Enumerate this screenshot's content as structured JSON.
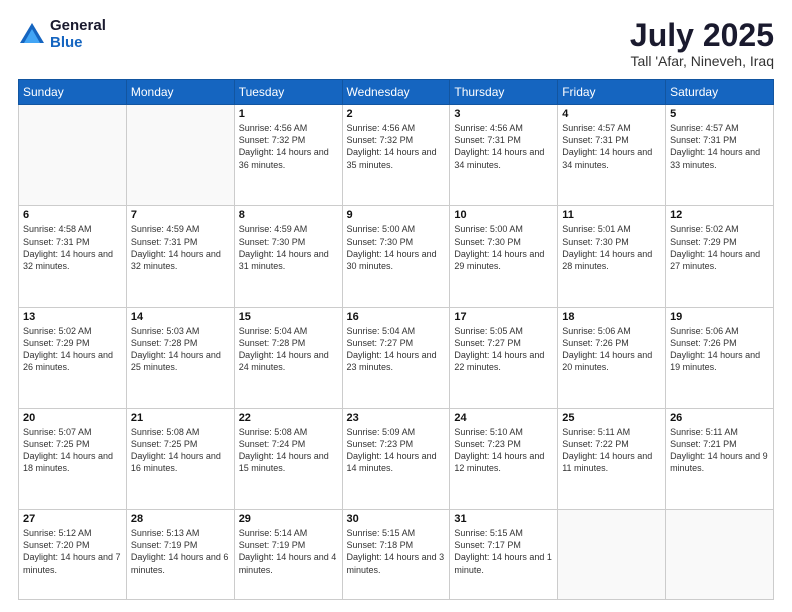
{
  "header": {
    "logo_general": "General",
    "logo_blue": "Blue",
    "title": "July 2025",
    "location": "Tall 'Afar, Nineveh, Iraq"
  },
  "weekdays": [
    "Sunday",
    "Monday",
    "Tuesday",
    "Wednesday",
    "Thursday",
    "Friday",
    "Saturday"
  ],
  "weeks": [
    [
      null,
      null,
      {
        "day": 1,
        "sunrise": "4:56 AM",
        "sunset": "7:32 PM",
        "daylight": "14 hours and 36 minutes."
      },
      {
        "day": 2,
        "sunrise": "4:56 AM",
        "sunset": "7:32 PM",
        "daylight": "14 hours and 35 minutes."
      },
      {
        "day": 3,
        "sunrise": "4:56 AM",
        "sunset": "7:31 PM",
        "daylight": "14 hours and 34 minutes."
      },
      {
        "day": 4,
        "sunrise": "4:57 AM",
        "sunset": "7:31 PM",
        "daylight": "14 hours and 34 minutes."
      },
      {
        "day": 5,
        "sunrise": "4:57 AM",
        "sunset": "7:31 PM",
        "daylight": "14 hours and 33 minutes."
      }
    ],
    [
      {
        "day": 6,
        "sunrise": "4:58 AM",
        "sunset": "7:31 PM",
        "daylight": "14 hours and 32 minutes."
      },
      {
        "day": 7,
        "sunrise": "4:59 AM",
        "sunset": "7:31 PM",
        "daylight": "14 hours and 32 minutes."
      },
      {
        "day": 8,
        "sunrise": "4:59 AM",
        "sunset": "7:30 PM",
        "daylight": "14 hours and 31 minutes."
      },
      {
        "day": 9,
        "sunrise": "5:00 AM",
        "sunset": "7:30 PM",
        "daylight": "14 hours and 30 minutes."
      },
      {
        "day": 10,
        "sunrise": "5:00 AM",
        "sunset": "7:30 PM",
        "daylight": "14 hours and 29 minutes."
      },
      {
        "day": 11,
        "sunrise": "5:01 AM",
        "sunset": "7:30 PM",
        "daylight": "14 hours and 28 minutes."
      },
      {
        "day": 12,
        "sunrise": "5:02 AM",
        "sunset": "7:29 PM",
        "daylight": "14 hours and 27 minutes."
      }
    ],
    [
      {
        "day": 13,
        "sunrise": "5:02 AM",
        "sunset": "7:29 PM",
        "daylight": "14 hours and 26 minutes."
      },
      {
        "day": 14,
        "sunrise": "5:03 AM",
        "sunset": "7:28 PM",
        "daylight": "14 hours and 25 minutes."
      },
      {
        "day": 15,
        "sunrise": "5:04 AM",
        "sunset": "7:28 PM",
        "daylight": "14 hours and 24 minutes."
      },
      {
        "day": 16,
        "sunrise": "5:04 AM",
        "sunset": "7:27 PM",
        "daylight": "14 hours and 23 minutes."
      },
      {
        "day": 17,
        "sunrise": "5:05 AM",
        "sunset": "7:27 PM",
        "daylight": "14 hours and 22 minutes."
      },
      {
        "day": 18,
        "sunrise": "5:06 AM",
        "sunset": "7:26 PM",
        "daylight": "14 hours and 20 minutes."
      },
      {
        "day": 19,
        "sunrise": "5:06 AM",
        "sunset": "7:26 PM",
        "daylight": "14 hours and 19 minutes."
      }
    ],
    [
      {
        "day": 20,
        "sunrise": "5:07 AM",
        "sunset": "7:25 PM",
        "daylight": "14 hours and 18 minutes."
      },
      {
        "day": 21,
        "sunrise": "5:08 AM",
        "sunset": "7:25 PM",
        "daylight": "14 hours and 16 minutes."
      },
      {
        "day": 22,
        "sunrise": "5:08 AM",
        "sunset": "7:24 PM",
        "daylight": "14 hours and 15 minutes."
      },
      {
        "day": 23,
        "sunrise": "5:09 AM",
        "sunset": "7:23 PM",
        "daylight": "14 hours and 14 minutes."
      },
      {
        "day": 24,
        "sunrise": "5:10 AM",
        "sunset": "7:23 PM",
        "daylight": "14 hours and 12 minutes."
      },
      {
        "day": 25,
        "sunrise": "5:11 AM",
        "sunset": "7:22 PM",
        "daylight": "14 hours and 11 minutes."
      },
      {
        "day": 26,
        "sunrise": "5:11 AM",
        "sunset": "7:21 PM",
        "daylight": "14 hours and 9 minutes."
      }
    ],
    [
      {
        "day": 27,
        "sunrise": "5:12 AM",
        "sunset": "7:20 PM",
        "daylight": "14 hours and 7 minutes."
      },
      {
        "day": 28,
        "sunrise": "5:13 AM",
        "sunset": "7:19 PM",
        "daylight": "14 hours and 6 minutes."
      },
      {
        "day": 29,
        "sunrise": "5:14 AM",
        "sunset": "7:19 PM",
        "daylight": "14 hours and 4 minutes."
      },
      {
        "day": 30,
        "sunrise": "5:15 AM",
        "sunset": "7:18 PM",
        "daylight": "14 hours and 3 minutes."
      },
      {
        "day": 31,
        "sunrise": "5:15 AM",
        "sunset": "7:17 PM",
        "daylight": "14 hours and 1 minute."
      },
      null,
      null
    ]
  ]
}
